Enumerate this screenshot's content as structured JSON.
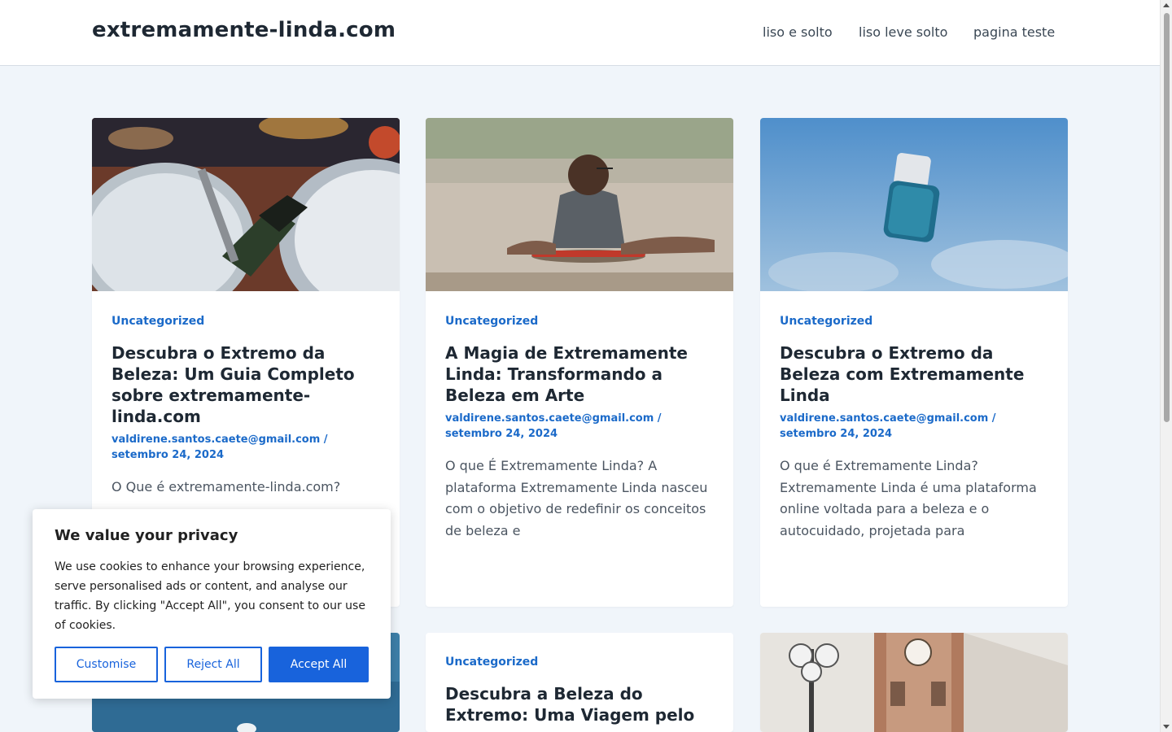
{
  "header": {
    "site_title": "extremamente-linda.com",
    "nav": [
      "liso e solto",
      "liso leve solto",
      "pagina teste"
    ]
  },
  "cards": [
    {
      "category": "Uncategorized",
      "title": "Descubra o Extremo da Beleza: Um Guia Completo sobre extremamente-linda.com",
      "author": "valdirene.santos.caete@gmail.com",
      "date": "setembro 24, 2024",
      "excerpt": "O Que é extremamente-linda.com?"
    },
    {
      "category": "Uncategorized",
      "title": "A Magia de Extremamente Linda: Transformando a Beleza em Arte",
      "author": "valdirene.santos.caete@gmail.com",
      "date": "setembro 24, 2024",
      "excerpt": "O que É Extremamente Linda? A plataforma Extremamente Linda nasceu com o objetivo de redefinir os conceitos de beleza e"
    },
    {
      "category": "Uncategorized",
      "title": "Descubra o Extremo da Beleza com Extremamente Linda",
      "author": "valdirene.santos.caete@gmail.com",
      "date": "setembro 24, 2024",
      "excerpt": "O que é Extremamente Linda? Extremamente Linda é uma plataforma online voltada para a beleza e o autocuidado, projetada para"
    },
    {
      "category": "Uncategorized",
      "title": "Descubra a Beleza do Extremo: Uma Viagem pelo"
    }
  ],
  "cookie": {
    "title": "We value your privacy",
    "text": "We use cookies to enhance your browsing experience, serve personalised ads or content, and analyse our traffic. By clicking \"Accept All\", you consent to our use of cookies.",
    "customise": "Customise",
    "reject": "Reject All",
    "accept": "Accept All"
  },
  "colors": {
    "accent": "#1b6ac9",
    "button": "#1863dc",
    "background": "#f0f5fa"
  }
}
